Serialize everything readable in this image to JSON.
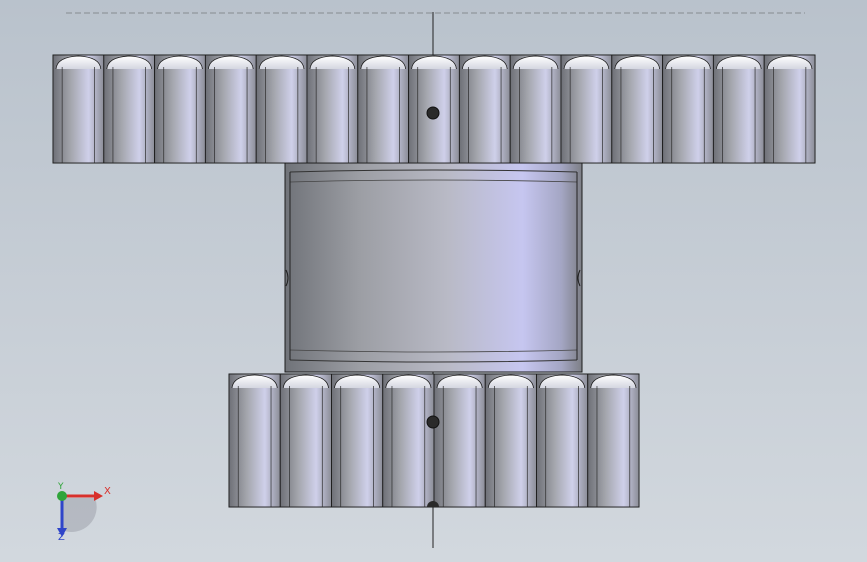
{
  "viewport": {
    "background_top": "#b9c2cc",
    "background_bottom": "#d2d8de"
  },
  "model": {
    "parts": [
      {
        "name": "upper-gear",
        "teeth_visible": 15
      },
      {
        "name": "hub-cylinder"
      },
      {
        "name": "lower-gear",
        "teeth_visible": 8
      }
    ],
    "colors": {
      "metal_dark": "#6f727a",
      "metal_mid": "#a9abb3",
      "metal_light": "#d9dbea",
      "metal_highlight": "#c9c9f4",
      "edge": "#1c1c1c"
    }
  },
  "triad": {
    "x_label": "X",
    "y_label": "Y",
    "z_label": "Z",
    "x_color": "#d8302b",
    "y_color": "#2fa43a",
    "z_color": "#2f45c9"
  }
}
